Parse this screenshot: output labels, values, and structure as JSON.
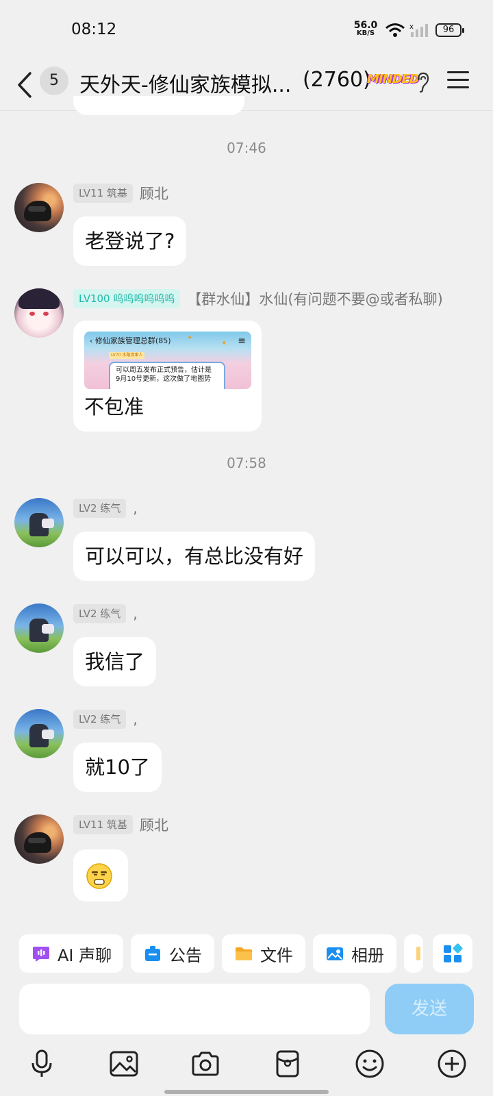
{
  "status_bar": {
    "time": "08:12",
    "net_speed": "56.0",
    "net_unit": "KB/S",
    "battery": "96"
  },
  "header": {
    "unread_count": "5",
    "title": "天外天-修仙家族模拟...",
    "member_count": "(2760)",
    "tag": "MINDED"
  },
  "messages": [
    {
      "timestamp": "07:46",
      "level": "LV11 筑基",
      "nickname": "顾北",
      "text": "老登说了?"
    },
    {
      "level": "LV100 呜呜呜呜呜呜",
      "nickname": "【群水仙】水仙(有问题不要@或者私聊)",
      "image_title": "修仙家族管理总群(85)",
      "image_level": "LV70 水路清事人",
      "image_text_1": "可以周五发布正式预告，估计是",
      "image_text_2": "9月10号更新，这次做了地图势",
      "text": "不包准"
    },
    {
      "timestamp": "07:58",
      "level": "LV2 练气",
      "nickname": ",",
      "text": "可以可以，有总比没有好"
    },
    {
      "level": "LV2 练气",
      "nickname": ",",
      "text": "我信了"
    },
    {
      "level": "LV2 练气",
      "nickname": ",",
      "text": "就10了"
    },
    {
      "level": "LV11 筑基",
      "nickname": "顾北",
      "sticker": "smirk-face-emoji"
    }
  ],
  "quick_actions": [
    {
      "label": "AI 声聊",
      "icon": "ai-voice-icon",
      "color": "#a04ff0"
    },
    {
      "label": "公告",
      "icon": "announcement-icon",
      "color": "#1a8ff0"
    },
    {
      "label": "文件",
      "icon": "folder-icon",
      "color": "#f5a623"
    },
    {
      "label": "相册",
      "icon": "album-icon",
      "color": "#1a8ff0"
    }
  ],
  "composer": {
    "send_label": "发送",
    "send_color": "#8fcdf6"
  },
  "toolbar": [
    {
      "icon": "microphone-icon"
    },
    {
      "icon": "image-icon"
    },
    {
      "icon": "camera-icon"
    },
    {
      "icon": "red-packet-icon"
    },
    {
      "icon": "emoji-icon"
    },
    {
      "icon": "plus-icon"
    }
  ]
}
